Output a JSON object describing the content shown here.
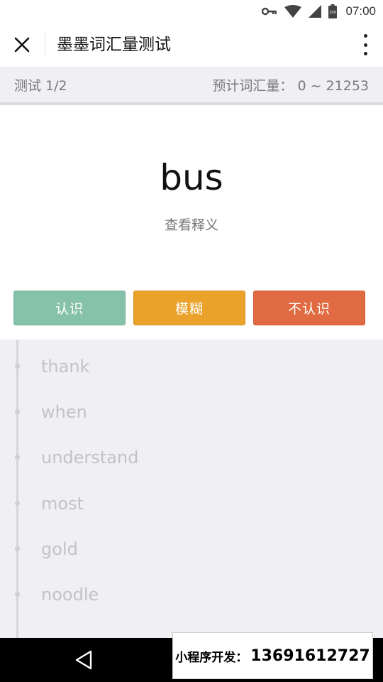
{
  "status_bar": {
    "time": "07:00",
    "icons": [
      "vpn-key-icon",
      "wifi-icon",
      "signal-icon",
      "battery-icon"
    ],
    "battery_label": "100"
  },
  "nav": {
    "title": "墨墨词汇量测试",
    "close_icon": "close-icon",
    "more_icon": "more-vertical-icon"
  },
  "info": {
    "progress": "测试 1/2",
    "estimate_label": "预计词汇量：",
    "estimate_range": "0 ~ 21253"
  },
  "card": {
    "word": "bus",
    "view_meaning": "查看释义"
  },
  "buttons": {
    "know": "认识",
    "vague": "模糊",
    "unknown": "不认识"
  },
  "history": [
    "thank",
    "when",
    "understand",
    "most",
    "gold",
    "noodle"
  ],
  "promo": {
    "label": "小程序开发：",
    "phone": "13691612727"
  },
  "colors": {
    "know": "#86c2aa",
    "vague": "#eaa22b",
    "unknown": "#e06a42",
    "panel_bg": "#efeff4"
  }
}
